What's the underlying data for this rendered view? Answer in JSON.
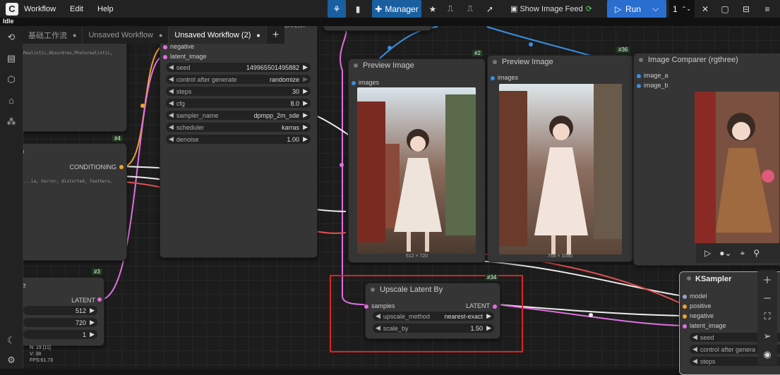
{
  "menu": {
    "items": [
      "Workflow",
      "Edit",
      "Help"
    ]
  },
  "toolbar": {
    "manager": "Manager",
    "show_feed": "Show Image Feed",
    "run": "Run",
    "queue_count": "1"
  },
  "status": {
    "queue_state": "Idle"
  },
  "tabs": [
    {
      "label": "基础工作流",
      "active": false
    },
    {
      "label": "Unsaved Workflow",
      "active": false
    },
    {
      "label": "Unsaved Workflow (2)",
      "active": true
    }
  ],
  "fps": {
    "n": "N: 19 [11]",
    "v": "V: 38",
    "fps": "FPS:61.73"
  },
  "nodes": {
    "prompt_pos": {
      "text": "Realistic,Absurdres,Photorealistic,"
    },
    "prompt_neg": {
      "id": "#4",
      "title": ")",
      "output": "CONDITIONING",
      "text": "...ia, horror, distorted, feathers."
    },
    "latent": {
      "id": "#3",
      "title": "e",
      "output": "LATENT",
      "values": [
        "512",
        "720",
        "1"
      ]
    },
    "ksampler_main": {
      "top_label": "LATENT",
      "inputs": [
        "negative",
        "latent_image"
      ],
      "widgets": [
        {
          "name": "seed",
          "value": "149965501495882"
        },
        {
          "name": "control after generate",
          "value": "randomize"
        },
        {
          "name": "steps",
          "value": "30"
        },
        {
          "name": "cfg",
          "value": "8.0"
        },
        {
          "name": "sampler_name",
          "value": "dpmpp_2m_sde"
        },
        {
          "name": "scheduler",
          "value": "karras"
        },
        {
          "name": "denoise",
          "value": "1.00"
        }
      ]
    },
    "preview1": {
      "id": "#2",
      "title": "Preview Image",
      "input": "images",
      "caption": "512 × 720"
    },
    "preview2": {
      "id": "#36",
      "title": "Preview Image",
      "input": "images",
      "caption": "768 × 1080"
    },
    "comparer": {
      "title": "Image Comparer (rgthree)",
      "inputs": [
        "image_a",
        "image_b"
      ]
    },
    "upscale": {
      "id": "#34",
      "title": "Upscale Latent By",
      "input": "samples",
      "output": "LATENT",
      "widgets": [
        {
          "name": "upscale_method",
          "value": "nearest-exact"
        },
        {
          "name": "scale_by",
          "value": "1.50"
        }
      ]
    },
    "ksampler2": {
      "title": "KSampler",
      "inputs": [
        "model",
        "positive",
        "negative",
        "latent_image"
      ],
      "widgets": [
        "seed",
        "control after genera",
        "steps"
      ]
    }
  },
  "colors": {
    "accent": "#1a5fa0",
    "highlight": "#d22",
    "link_pink": "#e070e0",
    "link_orange": "#f0a030",
    "link_blue": "#3a8ee0"
  }
}
